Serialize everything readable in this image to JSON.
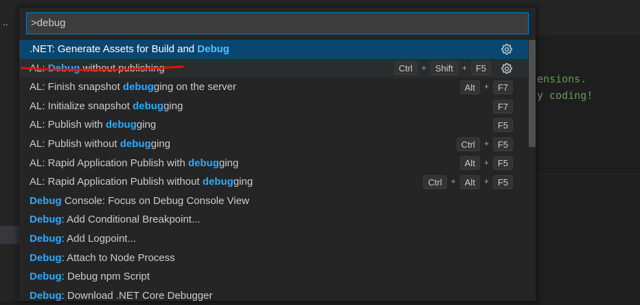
{
  "background": {
    "left_dots": "..",
    "editor_lines": [
      "ensions.",
      "y coding!"
    ]
  },
  "quick_open": {
    "query": ">debug",
    "items": [
      {
        "pre": ".NET: Generate Assets for Build and ",
        "hl": "Debug",
        "post": "",
        "keys": [],
        "gear": true,
        "state": "selected"
      },
      {
        "pre": "AL: ",
        "hl": "Debug",
        "post": " without publishing",
        "keys": [
          "Ctrl",
          "Shift",
          "F5"
        ],
        "gear": true,
        "state": "hover"
      },
      {
        "pre": "AL: Finish snapshot ",
        "hl": "debug",
        "post": "ging on the server",
        "keys": [
          "Alt",
          "F7"
        ],
        "gear": false
      },
      {
        "pre": "AL: Initialize snapshot ",
        "hl": "debug",
        "post": "ging",
        "keys": [
          "F7"
        ],
        "gear": false
      },
      {
        "pre": "AL: Publish with ",
        "hl": "debug",
        "post": "ging",
        "keys": [
          "F5"
        ],
        "gear": false
      },
      {
        "pre": "AL: Publish without ",
        "hl": "debug",
        "post": "ging",
        "keys": [
          "Ctrl",
          "F5"
        ],
        "gear": false
      },
      {
        "pre": "AL: Rapid Application Publish with ",
        "hl": "debug",
        "post": "ging",
        "keys": [
          "Alt",
          "F5"
        ],
        "gear": false
      },
      {
        "pre": "AL: Rapid Application Publish without ",
        "hl": "debug",
        "post": "ging",
        "keys": [
          "Ctrl",
          "Alt",
          "F5"
        ],
        "gear": false
      },
      {
        "pre": "",
        "hl": "Debug",
        "post": " Console: Focus on Debug Console View",
        "keys": [],
        "gear": false
      },
      {
        "pre": "",
        "hl": "Debug",
        "post": ": Add Conditional Breakpoint...",
        "keys": [],
        "gear": false
      },
      {
        "pre": "",
        "hl": "Debug",
        "post": ": Add Logpoint...",
        "keys": [],
        "gear": false
      },
      {
        "pre": "",
        "hl": "Debug",
        "post": ": Attach to Node Process",
        "keys": [],
        "gear": false
      },
      {
        "pre": "",
        "hl": "Debug",
        "post": ": Debug npm Script",
        "keys": [],
        "gear": false
      },
      {
        "pre": "",
        "hl": "Debug",
        "post": ": Download .NET Core Debugger",
        "keys": [],
        "gear": false
      }
    ]
  },
  "colors": {
    "accent": "#007fd4",
    "selected_row": "#094771",
    "highlight": "#2aaaff",
    "annotation": "#e51400"
  },
  "icons": {
    "gear": "gear-icon"
  }
}
